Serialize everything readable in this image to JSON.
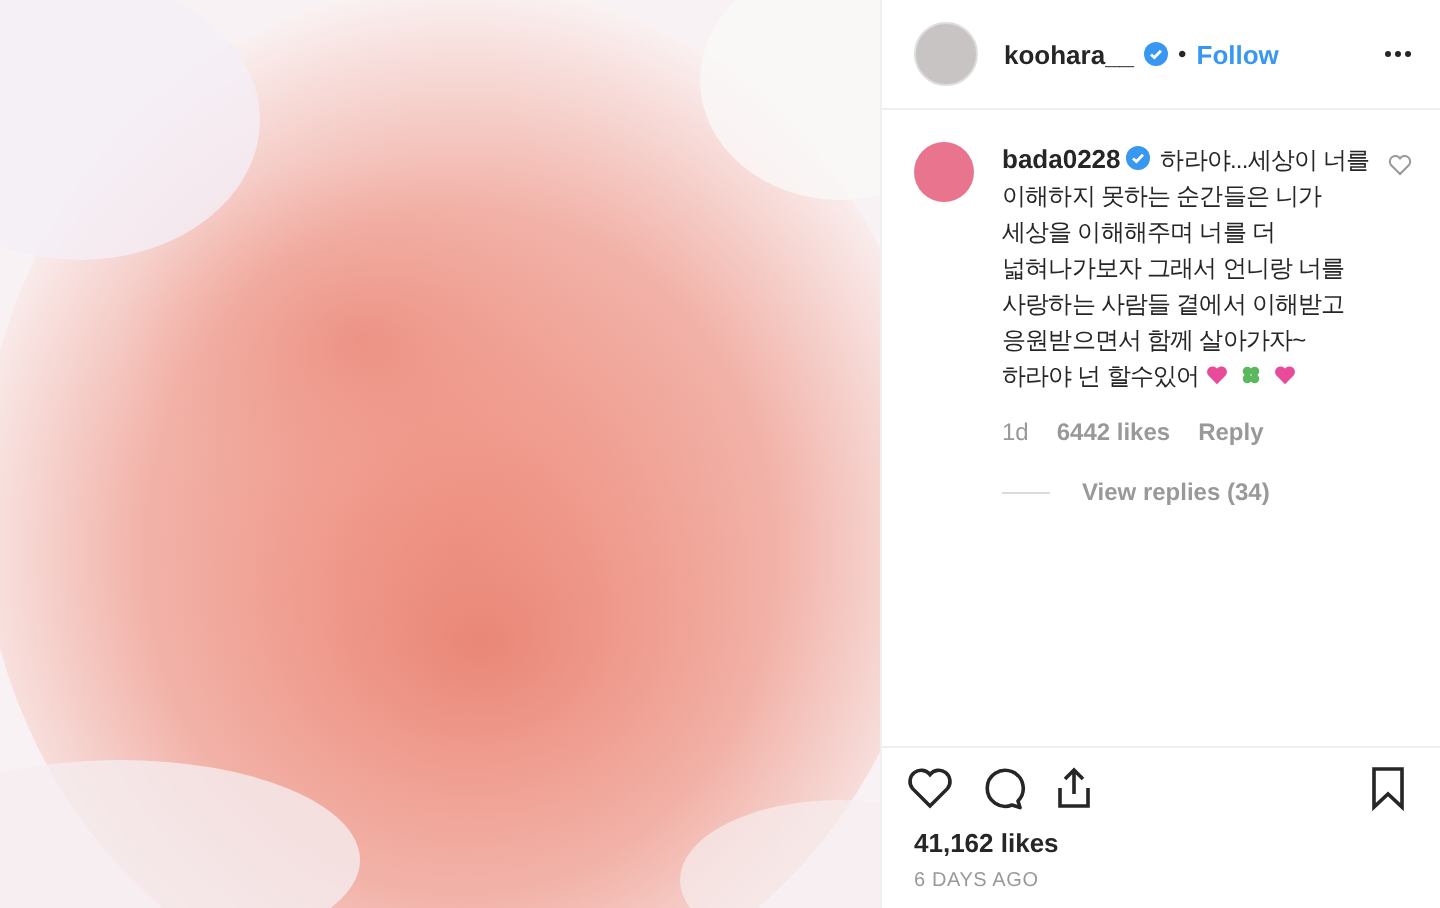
{
  "header": {
    "username": "koohara__",
    "verified": true,
    "separator": "•",
    "follow": "Follow"
  },
  "comments": [
    {
      "username": "bada0228",
      "verified": true,
      "text": "하라야...세상이 너를 이해하지 못하는 순간들은 니가 세상을 이해해주며 너를 더 넓혀나가보자 그래서 언니랑 너를 사랑하는 사람들 곁에서 이해받고 응원받으면서 함께 살아가자~하라야 넌 할수있어",
      "liked": false,
      "time": "1d",
      "likes": "6442 likes",
      "reply": "Reply",
      "view_replies": "View replies (34)"
    }
  ],
  "actions": {
    "liked": false,
    "saved": false
  },
  "likes": "41,162 likes",
  "date": "6 DAYS AGO"
}
